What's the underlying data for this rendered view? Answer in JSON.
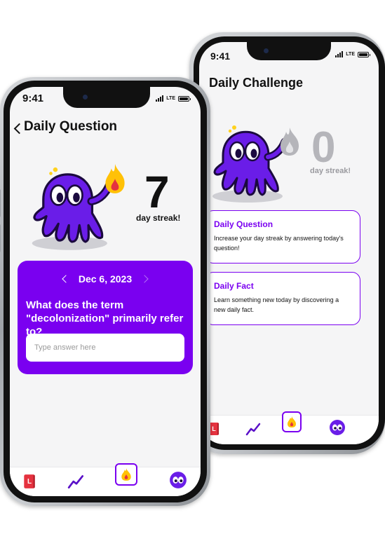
{
  "status": {
    "time": "9:41",
    "network": "LTE"
  },
  "question_screen": {
    "title": "Daily Question",
    "streak_number": "7",
    "streak_label": "day streak!",
    "date": "Dec 6, 2023",
    "question": "What does the term \"decolonization\" primarily refer to?",
    "answer_placeholder": "Type answer here"
  },
  "challenge_screen": {
    "title": "Daily Challenge",
    "streak_number": "0",
    "streak_label": "day streak!",
    "cards": [
      {
        "title": "Daily Question",
        "body": "Increase your day streak by answering today's question!"
      },
      {
        "title": "Daily Fact",
        "body": "Learn something new today by discovering a new daily fact."
      }
    ]
  },
  "nav": {
    "items": [
      "lesson-icon",
      "progress-chart-icon",
      "streak-flame-icon",
      "profile-eyes-icon"
    ],
    "selected_index": 2,
    "lesson_letter": "L"
  },
  "colors": {
    "accent": "#7a00f0",
    "octopus": "#6a1de8",
    "flame": "#ffc107",
    "lesson": "#e5323f"
  }
}
